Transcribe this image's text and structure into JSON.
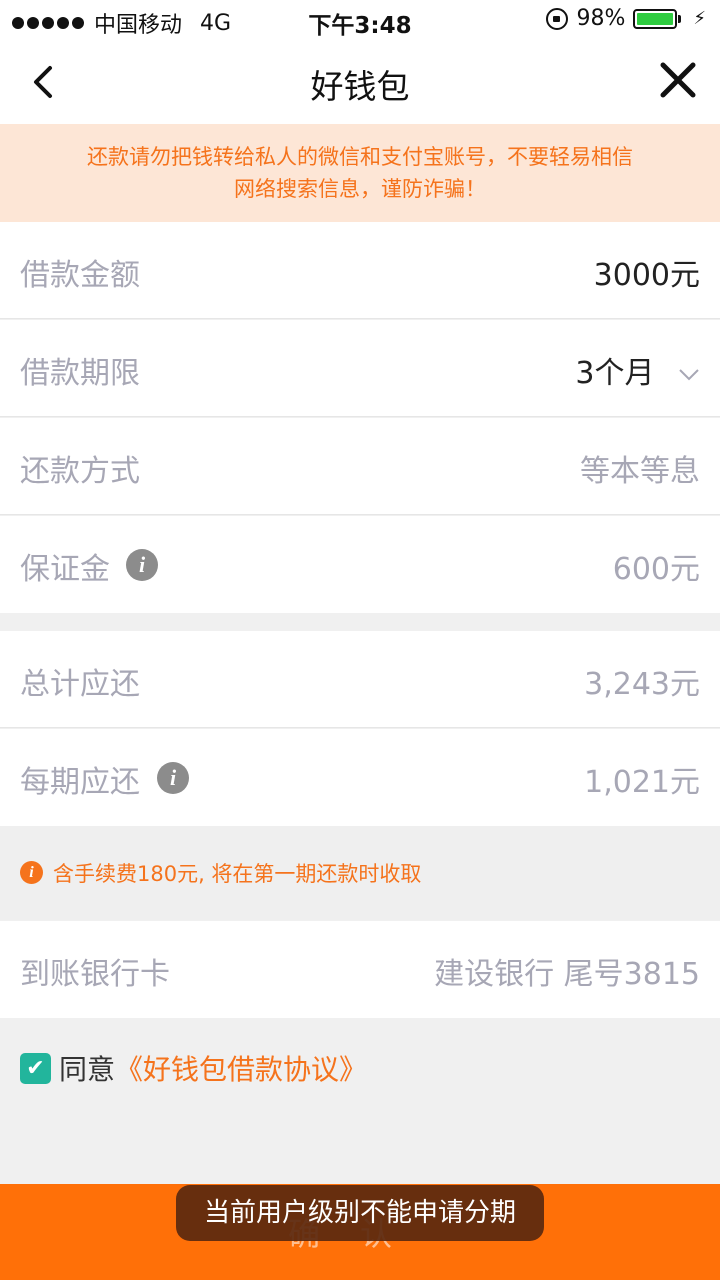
{
  "status_bar": {
    "carrier": "中国移动",
    "network": "4G",
    "time": "下午3:48",
    "battery_percent": "98%",
    "battery_level": 0.98
  },
  "nav": {
    "title": "好钱包",
    "back_icon": "chevron-left-icon",
    "close_icon": "close-icon"
  },
  "banner": {
    "line1": "还款请勿把钱转给私人的微信和支付宝账号，不要轻易相信",
    "line2": "网络搜索信息，谨防诈骗！"
  },
  "loan": {
    "amount_label": "借款金额",
    "amount_value": "3000元",
    "term_label": "借款期限",
    "term_value": "3个月",
    "method_label": "还款方式",
    "method_value": "等本等息",
    "deposit_label": "保证金",
    "deposit_value": "600元"
  },
  "repay": {
    "total_label": "总计应还",
    "total_value": "3,243元",
    "per_period_label": "每期应还",
    "per_period_value": "1,021元"
  },
  "notice": {
    "text": "含手续费180元, 将在第一期还款时收取"
  },
  "bank": {
    "label": "到账银行卡",
    "value": "建设银行 尾号3815"
  },
  "agreement": {
    "checked": true,
    "prefix": "同意",
    "link": "《好钱包借款协议》"
  },
  "confirm_label": "确认",
  "toast": "当前用户级别不能申请分期",
  "colors": {
    "accent": "#ff7008",
    "banner_bg": "#fde6d6",
    "banner_text": "#f5731c",
    "check": "#22b59c"
  }
}
